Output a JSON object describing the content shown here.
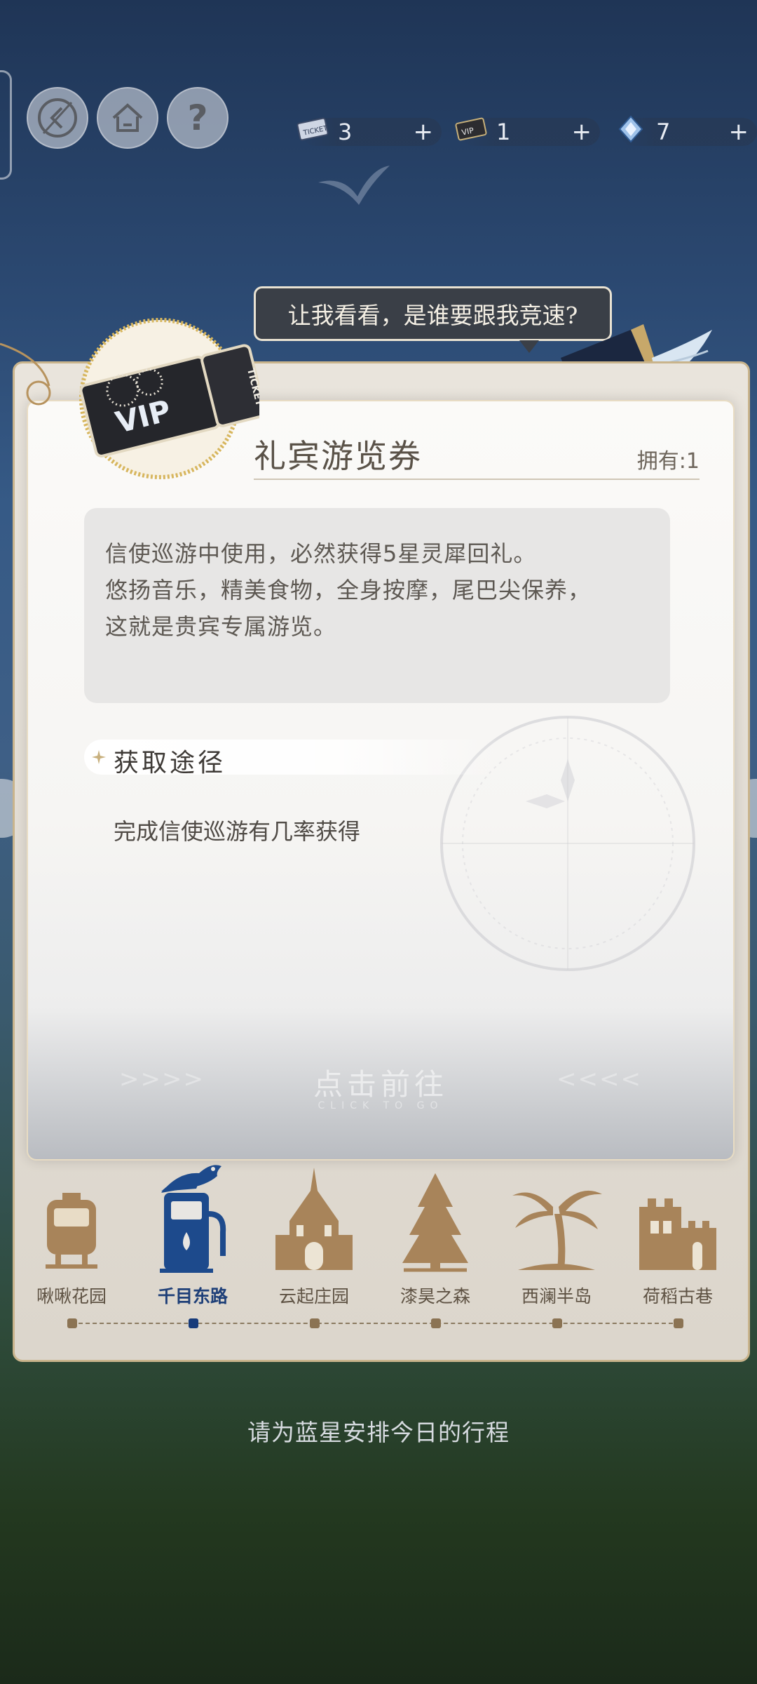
{
  "top_bar": {
    "resources": [
      {
        "icon": "ticket-icon",
        "count": "3",
        "add": "+"
      },
      {
        "icon": "vip-ticket-icon",
        "count": "1",
        "add": "+"
      },
      {
        "icon": "crystal-icon",
        "count": "7",
        "add": "+"
      }
    ],
    "help_label": "?"
  },
  "speech_bubble": "让我看看，是谁要跟我竞速?",
  "item": {
    "ticket_art": {
      "vip": "VIP",
      "ticket": "TICKET"
    },
    "name": "礼宾游览券",
    "owned": "拥有:1",
    "description": [
      "信使巡游中使用，必然获得5星灵犀回礼。",
      "悠扬音乐，精美食物，全身按摩，尾巴尖保养，",
      "这就是贵宾专属游览。"
    ],
    "source_title": "获取途径",
    "source_text": "完成信使巡游有几率获得",
    "go_label": "点击前往",
    "go_sublabel": "CLICK TO GO",
    "go_arrows_left": ">>>>",
    "go_arrows_right": "<<<<"
  },
  "destinations": [
    {
      "label": "啾啾花园",
      "icon": "tram-icon",
      "active": false
    },
    {
      "label": "千目东路",
      "icon": "fuel-pump-icon",
      "active": true
    },
    {
      "label": "云起庄园",
      "icon": "manor-icon",
      "active": false
    },
    {
      "label": "漆昊之森",
      "icon": "forest-icon",
      "active": false
    },
    {
      "label": "西澜半岛",
      "icon": "palm-tree-icon",
      "active": false
    },
    {
      "label": "荷稻古巷",
      "icon": "castle-icon",
      "active": false
    }
  ],
  "footer_hint": "请为蓝星安排今日的行程",
  "colors": {
    "accent_active": "#173b7a",
    "dest_icon": "#a8845a",
    "card_border": "#c9b48c"
  }
}
